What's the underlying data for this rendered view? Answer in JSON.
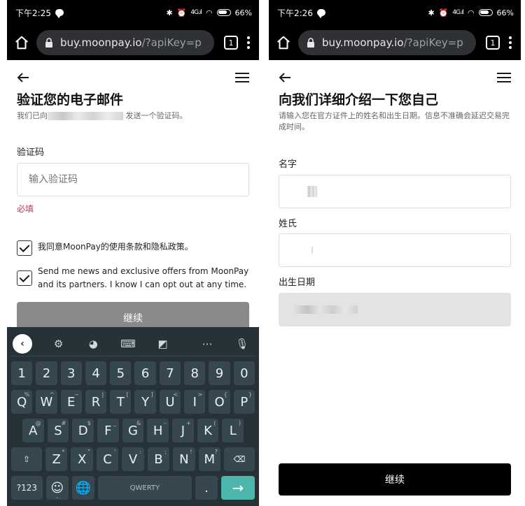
{
  "left": {
    "status": {
      "time": "下午2:25",
      "battery": "66%",
      "signal": "4G.ıl"
    },
    "browser": {
      "url_host": "buy.moonpay.io",
      "url_rest": "/?apiKey=p",
      "tab_count": "1"
    },
    "title": "验证您的电子邮件",
    "subtitle_prefix": "我们已向",
    "subtitle_suffix": "发送一个验证码。",
    "code_label": "验证码",
    "code_placeholder": "输入验证码",
    "required": "必填",
    "terms_text": "我同意MoonPay的使用条款和隐私政策。",
    "news_text": "Send me news and exclusive offers from MoonPay and its partners. I know I can opt out at any time.",
    "continue": "继续"
  },
  "keyboard": {
    "numbers": [
      "1",
      "2",
      "3",
      "4",
      "5",
      "6",
      "7",
      "8",
      "9",
      "0"
    ],
    "row1": [
      {
        "k": "Q",
        "h": "%"
      },
      {
        "k": "W",
        "h": "^"
      },
      {
        "k": "E",
        "h": "~"
      },
      {
        "k": "R",
        "h": "|"
      },
      {
        "k": "T",
        "h": "["
      },
      {
        "k": "Y",
        "h": "]"
      },
      {
        "k": "U",
        "h": "<"
      },
      {
        "k": "I",
        "h": ">"
      },
      {
        "k": "O",
        "h": "{"
      },
      {
        "k": "P",
        "h": "}"
      }
    ],
    "row2": [
      {
        "k": "A",
        "h": "@"
      },
      {
        "k": "S",
        "h": "#"
      },
      {
        "k": "D",
        "h": "$"
      },
      {
        "k": "F",
        "h": "_"
      },
      {
        "k": "G",
        "h": "&"
      },
      {
        "k": "H",
        "h": "-"
      },
      {
        "k": "J",
        "h": "+"
      },
      {
        "k": "K",
        "h": "("
      },
      {
        "k": "L",
        "h": ")"
      }
    ],
    "row3": [
      {
        "k": "Z",
        "h": "*"
      },
      {
        "k": "X",
        "h": "\""
      },
      {
        "k": "C",
        "h": "'"
      },
      {
        "k": "V",
        "h": ":"
      },
      {
        "k": "B",
        "h": ";"
      },
      {
        "k": "N",
        "h": "!"
      },
      {
        "k": "M",
        "h": "?"
      }
    ],
    "sym": "?123",
    "emoji": "☺",
    "comma": ",",
    "space": "QWERTY",
    "period": ".",
    "enter": "→"
  },
  "right": {
    "status": {
      "time": "下午2:26",
      "battery": "66%",
      "signal": "4G.ıl"
    },
    "browser": {
      "url_host": "buy.moonpay.io",
      "url_rest": "/?apiKey=p",
      "tab_count": "1"
    },
    "title": "向我们详细介绍一下您自己",
    "subtitle": "请输入您在官方证件上的姓名和出生日期。信息不准确会延迟交易完成时间。",
    "first_name_label": "名字",
    "last_name_label": "姓氏",
    "dob_label": "出生日期",
    "continue": "继续"
  }
}
